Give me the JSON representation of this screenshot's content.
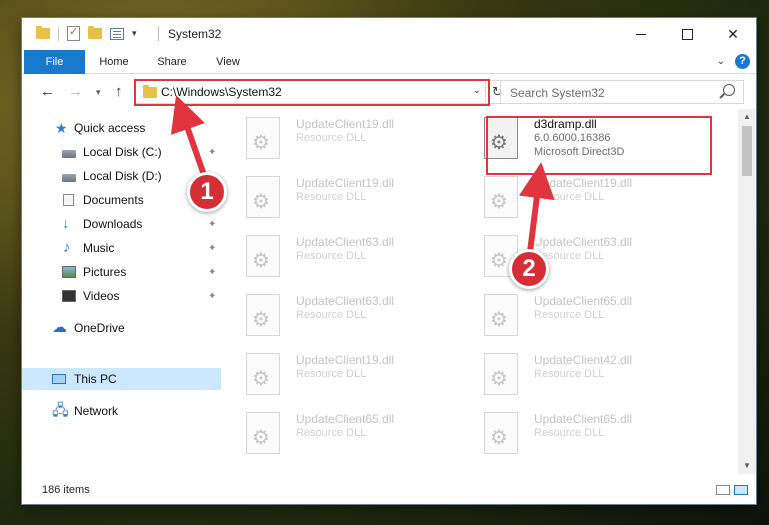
{
  "window": {
    "title": "System32",
    "minimize_glyph": "",
    "maximize_glyph": "",
    "close_glyph": "✕"
  },
  "ribbon": {
    "tabs": [
      {
        "label": "File",
        "active": true
      },
      {
        "label": "Home"
      },
      {
        "label": "Share"
      },
      {
        "label": "View"
      }
    ],
    "help_glyph": "?"
  },
  "nav": {
    "back_glyph": "←",
    "forward_glyph": "→",
    "recent_glyph": "▾",
    "up_glyph": "↑",
    "address": "C:\\Windows\\System32",
    "dropdown_glyph": "⌄",
    "refresh_glyph": "↻",
    "search_placeholder": "Search System32"
  },
  "sidebar": {
    "items": [
      {
        "label": "Quick access",
        "icon": "star-icon"
      },
      {
        "label": "Local Disk (C:)",
        "icon": "drive-icon",
        "pinned": true
      },
      {
        "label": "Local Disk (D:)",
        "icon": "drive-icon"
      },
      {
        "label": "Documents",
        "icon": "documents-icon"
      },
      {
        "label": "Downloads",
        "icon": "downloads-icon",
        "pinned": true
      },
      {
        "label": "Music",
        "icon": "music-icon",
        "pinned": true
      },
      {
        "label": "Pictures",
        "icon": "pictures-icon",
        "pinned": true
      },
      {
        "label": "Videos",
        "icon": "videos-icon",
        "pinned": true
      },
      {
        "label": "OneDrive",
        "icon": "cloud-icon"
      },
      {
        "label": "This PC",
        "icon": "computer-icon",
        "selected": true
      },
      {
        "label": "Network",
        "icon": "network-icon"
      }
    ],
    "pin_glyph": "📌"
  },
  "files": {
    "highlighted": {
      "name": "d3dramp.dll",
      "version": "6.0.6000.16386",
      "description": "Microsoft Direct3D"
    },
    "left_column": [
      {
        "name": "UpdateClient19.dll",
        "type": "Resource DLL"
      },
      {
        "name": "UpdateClient19.dll",
        "type": "Resource DLL"
      },
      {
        "name": "UpdateClient63.dll",
        "type": "Resource DLL"
      },
      {
        "name": "UpdateClient63.dll",
        "type": "Resource DLL"
      },
      {
        "name": "UpdateClient19.dll",
        "type": "Resource DLL"
      },
      {
        "name": "UpdateClient65.dll",
        "type": "Resource DLL"
      }
    ],
    "right_column": [
      {
        "name": "UpdateClient19.dll",
        "type": "Resource DLL"
      },
      {
        "name": "UpdateClient63.dll",
        "type": "Resource DLL"
      },
      {
        "name": "UpdateClient65.dll",
        "type": "Resource DLL"
      },
      {
        "name": "UpdateClient42.dll",
        "type": "Resource DLL"
      },
      {
        "name": "UpdateClient65.dll",
        "type": "Resource DLL"
      }
    ]
  },
  "scrollbar": {
    "up_glyph": "▲",
    "down_glyph": "▼"
  },
  "status": {
    "item_count": "186 items"
  },
  "annotations": {
    "badge_1": "1",
    "badge_2": "2",
    "accent_color": "#e0353f"
  }
}
